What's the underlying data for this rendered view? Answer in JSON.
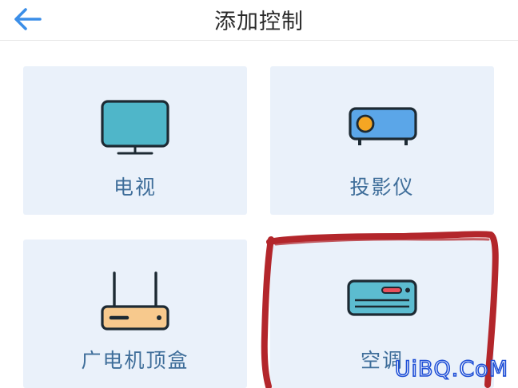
{
  "header": {
    "title": "添加控制",
    "back_icon": "arrow-left-icon",
    "accent_color": "#3b8ee8"
  },
  "devices": [
    {
      "label": "电视",
      "icon": "tv-icon"
    },
    {
      "label": "投影仪",
      "icon": "projector-icon"
    },
    {
      "label": "广电机顶盒",
      "icon": "set-top-box-icon"
    },
    {
      "label": "空调",
      "icon": "air-conditioner-icon"
    }
  ],
  "annotation": {
    "color": "#b3262b"
  },
  "watermark": {
    "text": "UiBQ.CoM"
  }
}
